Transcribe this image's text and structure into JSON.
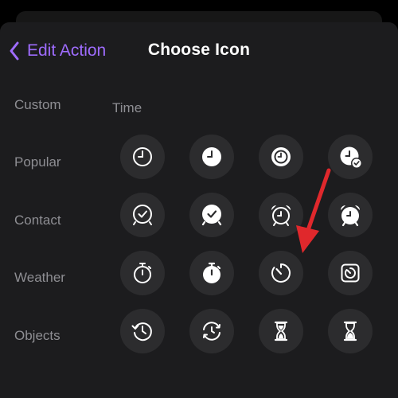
{
  "header": {
    "back_label": "Edit Action",
    "title": "Choose Icon"
  },
  "categories": [
    "Custom",
    "Popular",
    "Contact",
    "Weather",
    "Objects"
  ],
  "section": {
    "title": "Time"
  },
  "icons": [
    [
      "clock-icon",
      "clock-filled-icon",
      "clock-circle-icon",
      "clock-badge-checkmark-icon"
    ],
    [
      "deskclock-icon",
      "deskclock-filled-icon",
      "alarm-icon",
      "alarm-filled-icon"
    ],
    [
      "stopwatch-icon",
      "stopwatch-filled-icon",
      "timer-icon",
      "timer-square-icon"
    ],
    [
      "clock-arrow-counterclockwise-icon",
      "clock-arrow-circlepath-icon",
      "hourglass-icon",
      "hourglass-bottomhalf-icon"
    ]
  ],
  "colors": {
    "accent": "#9f6cff",
    "background": "#1c1c1e",
    "tile": "#2c2c2e",
    "arrow": "#e0282c"
  }
}
